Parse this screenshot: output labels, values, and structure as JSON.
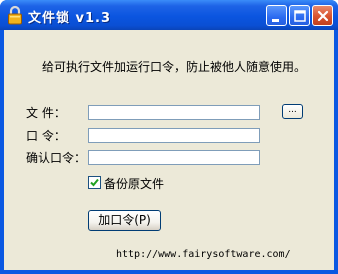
{
  "window": {
    "title": "文件锁 v1.3",
    "icon": "padlock-icon"
  },
  "titlebar_buttons": {
    "minimize_icon": "minimize-icon",
    "maximize_icon": "maximize-icon",
    "close_icon": "close-icon"
  },
  "description": "给可执行文件加运行口令，防止被他人随意使用。",
  "form": {
    "file_label": "文    件：",
    "file_value": "",
    "browse_label": "...",
    "password_label": "口    令：",
    "password_value": "",
    "confirm_label": "确认口令：",
    "confirm_value": ""
  },
  "backup": {
    "label": "备份原文件",
    "checked": true
  },
  "add_button_label": "加口令(P)",
  "footer_url": "http://www.fairysoftware.com/",
  "colors": {
    "titlebar": "#0a55e0",
    "client_bg": "#ece9d8",
    "close_button": "#d8532f"
  }
}
